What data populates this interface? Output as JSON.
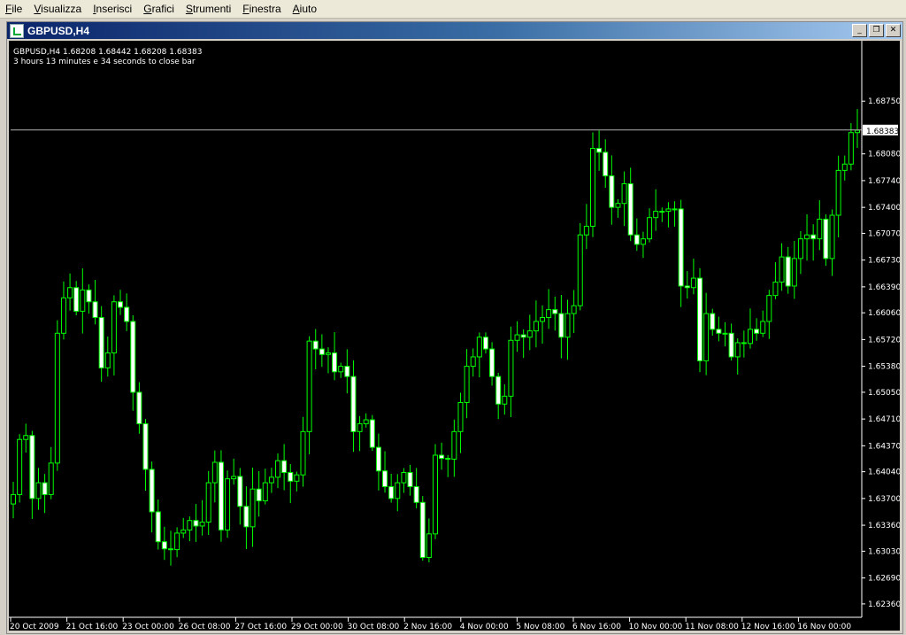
{
  "menu": {
    "items": [
      {
        "label": "File",
        "name": "menu-file"
      },
      {
        "label": "Visualizza",
        "name": "menu-visualizza"
      },
      {
        "label": "Inserisci",
        "name": "menu-inserisci"
      },
      {
        "label": "Grafici",
        "name": "menu-grafici"
      },
      {
        "label": "Strumenti",
        "name": "menu-strumenti"
      },
      {
        "label": "Finestra",
        "name": "menu-finestra"
      },
      {
        "label": "Aiuto",
        "name": "menu-aiuto"
      }
    ]
  },
  "window": {
    "title": "GBPUSD,H4",
    "minimize_label": "_",
    "restore_label": "❐",
    "close_label": "✕"
  },
  "chart": {
    "info_line": "GBPUSD,H4  1.68208 1.68442 1.68208 1.68383",
    "countdown_line": "3 hours 13 minutes e 34 seconds to close bar",
    "current_price_label": "1.68383",
    "colors": {
      "background": "#000000",
      "candle_up_fill": "#000000",
      "candle_down_fill": "#ffffff",
      "wick": "#00ff00",
      "price_line": "#b0b0b0",
      "axis_text": "#ffffff"
    }
  },
  "chart_data": {
    "type": "candlestick",
    "symbol": "GBPUSD",
    "timeframe": "H4",
    "ylim": [
      1.6219,
      1.6918
    ],
    "y_ticks": [
      "1.68750",
      "1.68080",
      "1.67740",
      "1.67400",
      "1.67070",
      "1.66730",
      "1.66390",
      "1.66060",
      "1.65720",
      "1.65380",
      "1.65050",
      "1.64710",
      "1.64370",
      "1.64040",
      "1.63700",
      "1.63360",
      "1.63030",
      "1.62690",
      "1.62360"
    ],
    "x_ticks": [
      "20 Oct 2009",
      "21 Oct 16:00",
      "23 Oct 00:00",
      "26 Oct 08:00",
      "27 Oct 16:00",
      "29 Oct 00:00",
      "30 Oct 08:00",
      "2 Nov 16:00",
      "4 Nov 00:00",
      "5 Nov 08:00",
      "6 Nov 16:00",
      "10 Nov 00:00",
      "11 Nov 08:00",
      "12 Nov 16:00",
      "16 Nov 00:00"
    ],
    "current_price": 1.68383,
    "closes": [
      1.6375,
      1.6445,
      1.645,
      1.637,
      1.639,
      1.6375,
      1.6415,
      1.658,
      1.6625,
      1.6638,
      1.6608,
      1.6635,
      1.662,
      1.66,
      1.6536,
      1.6555,
      1.662,
      1.6613,
      1.6595,
      1.6505,
      1.6465,
      1.6407,
      1.6353,
      1.6315,
      1.6306,
      1.6305,
      1.6326,
      1.633,
      1.6342,
      1.6335,
      1.634,
      1.639,
      1.6416,
      1.633,
      1.6395,
      1.6398,
      1.636,
      1.6334,
      1.6382,
      1.6367,
      1.639,
      1.6397,
      1.6418,
      1.6403,
      1.6392,
      1.64,
      1.6455,
      1.657,
      1.656,
      1.6553,
      1.6555,
      1.6531,
      1.6538,
      1.6525,
      1.6455,
      1.6465,
      1.647,
      1.6435,
      1.6405,
      1.6385,
      1.637,
      1.639,
      1.6403,
      1.6385,
      1.6365,
      1.6295,
      1.6325,
      1.6425,
      1.6421,
      1.642,
      1.6455,
      1.6492,
      1.6538,
      1.655,
      1.6575,
      1.656,
      1.6525,
      1.649,
      1.65,
      1.6571,
      1.6578,
      1.6575,
      1.6583,
      1.6595,
      1.66,
      1.661,
      1.6605,
      1.6575,
      1.6605,
      1.6615,
      1.6705,
      1.6716,
      1.6815,
      1.681,
      1.678,
      1.674,
      1.6745,
      1.677,
      1.6705,
      1.6693,
      1.67,
      1.6727,
      1.6735,
      1.6735,
      1.6738,
      1.6738,
      1.664,
      1.6638,
      1.665,
      1.6545,
      1.6605,
      1.6585,
      1.658,
      1.658,
      1.655,
      1.6568,
      1.6567,
      1.6585,
      1.658,
      1.6595,
      1.6628,
      1.6645,
      1.6677,
      1.664,
      1.6675,
      1.67,
      1.6705,
      1.67,
      1.6725,
      1.6675,
      1.673,
      1.6787,
      1.6795,
      1.6835,
      1.6838
    ]
  }
}
